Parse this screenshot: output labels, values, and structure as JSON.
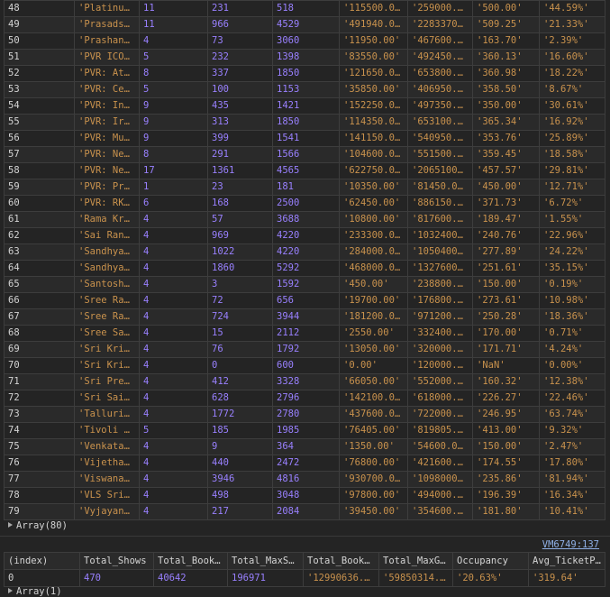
{
  "rows": [
    [
      "48",
      "'Platinum …",
      "11",
      "231",
      "518",
      "'115500.00'",
      "'259000.00'",
      "'500.00'",
      "'44.59%'"
    ],
    [
      "49",
      "'Prasads M…",
      "11",
      "966",
      "4529",
      "'491940.00'",
      "'2283370.0…",
      "'509.25'",
      "'21.33%'"
    ],
    [
      "50",
      "'Prashant …",
      "4",
      "73",
      "3060",
      "'11950.00'",
      "'467600.00'",
      "'163.70'",
      "'2.39%'"
    ],
    [
      "51",
      "'PVR ICON:…",
      "5",
      "232",
      "1398",
      "'83550.00'",
      "'492450.00'",
      "'360.13'",
      "'16.60%'"
    ],
    [
      "52",
      "'PVR: Atri…",
      "8",
      "337",
      "1850",
      "'121650.00'",
      "'653800.00'",
      "'360.98'",
      "'18.22%'"
    ],
    [
      "53",
      "'PVR: Cent…",
      "5",
      "100",
      "1153",
      "'35850.00'",
      "'406950.00'",
      "'358.50'",
      "'8.67%'"
    ],
    [
      "54",
      "'PVR: Inor…",
      "9",
      "435",
      "1421",
      "'152250.00'",
      "'497350.00'",
      "'350.00'",
      "'30.61%'"
    ],
    [
      "55",
      "'PVR: Irru…",
      "9",
      "313",
      "1850",
      "'114350.00'",
      "'653100.00'",
      "'365.34'",
      "'16.92%'"
    ],
    [
      "56",
      "'PVR: Musa…",
      "9",
      "399",
      "1541",
      "'141150.00'",
      "'540950.00'",
      "'353.76'",
      "'25.89%'"
    ],
    [
      "57",
      "'PVR: Next…",
      "8",
      "291",
      "1566",
      "'104600.00'",
      "'551500.00'",
      "'359.45'",
      "'18.58%'"
    ],
    [
      "58",
      "'PVR: Nexu…",
      "17",
      "1361",
      "4565",
      "'622750.00'",
      "'2065100.0…",
      "'457.57'",
      "'29.81%'"
    ],
    [
      "59",
      "'PVR: Pres…",
      "1",
      "23",
      "181",
      "'10350.00'",
      "'81450.00'",
      "'450.00'",
      "'12.71%'"
    ],
    [
      "60",
      "'PVR: RK C…",
      "6",
      "168",
      "2500",
      "'62450.00'",
      "'886150.00'",
      "'371.73'",
      "'6.72%'"
    ],
    [
      "61",
      "'Rama Kris…",
      "4",
      "57",
      "3688",
      "'10800.00'",
      "'817600.00'",
      "'189.47'",
      "'1.55%'"
    ],
    [
      "62",
      "'Sai Ranga…",
      "4",
      "969",
      "4220",
      "'233300.00'",
      "'1032400.0…",
      "'240.76'",
      "'22.96%'"
    ],
    [
      "63",
      "'Sandhya 3…",
      "4",
      "1022",
      "4220",
      "'284000.00'",
      "'1050400.0…",
      "'277.89'",
      "'24.22%'"
    ],
    [
      "64",
      "'Sandhya 7…",
      "4",
      "1860",
      "5292",
      "'468000.00'",
      "'1327600.0…",
      "'251.61'",
      "'35.15%'"
    ],
    [
      "65",
      "'Santosh T…",
      "4",
      "3",
      "1592",
      "'450.00'",
      "'238800.00'",
      "'150.00'",
      "'0.19%'"
    ],
    [
      "66",
      "'Sree Rama…",
      "4",
      "72",
      "656",
      "'19700.00'",
      "'176800.00'",
      "'273.61'",
      "'10.98%'"
    ],
    [
      "67",
      "'Sree Ramu…",
      "4",
      "724",
      "3944",
      "'181200.00'",
      "'971200.00'",
      "'250.28'",
      "'18.36%'"
    ],
    [
      "68",
      "'Sree Sai …",
      "4",
      "15",
      "2112",
      "'2550.00'",
      "'332400.00'",
      "'170.00'",
      "'0.71%'"
    ],
    [
      "69",
      "'Sri Krish…",
      "4",
      "76",
      "1792",
      "'13050.00'",
      "'320000.00'",
      "'171.71'",
      "'4.24%'"
    ],
    [
      "70",
      "'Sri Krish…",
      "4",
      "0",
      "600",
      "'0.00'",
      "'120000.00'",
      "'NaN'",
      "'0.00%'"
    ],
    [
      "71",
      "'Sri Prema…",
      "4",
      "412",
      "3328",
      "'66050.00'",
      "'552000.00'",
      "'160.32'",
      "'12.38%'"
    ],
    [
      "72",
      "'Sri Sai R…",
      "4",
      "628",
      "2796",
      "'142100.00'",
      "'618000.00'",
      "'226.27'",
      "'22.46%'"
    ],
    [
      "73",
      "'Talluri T…",
      "4",
      "1772",
      "2780",
      "'437600.00'",
      "'722000.00'",
      "'246.95'",
      "'63.74%'"
    ],
    [
      "74",
      "'Tivoli Ci…",
      "5",
      "185",
      "1985",
      "'76405.00'",
      "'819805.00'",
      "'413.00'",
      "'9.32%'"
    ],
    [
      "75",
      "'Venkata S…",
      "4",
      "9",
      "364",
      "'1350.00'",
      "'54600.00'",
      "'150.00'",
      "'2.47%'"
    ],
    [
      "76",
      "'Vijetha 7…",
      "4",
      "440",
      "2472",
      "'76800.00'",
      "'421600.00'",
      "'174.55'",
      "'17.80%'"
    ],
    [
      "77",
      "'Viswanath…",
      "4",
      "3946",
      "4816",
      "'930700.00'",
      "'1098000.0…",
      "'235.86'",
      "'81.94%'"
    ],
    [
      "78",
      "'VLS Sride…",
      "4",
      "498",
      "3048",
      "'97800.00'",
      "'494000.00'",
      "'196.39'",
      "'16.34%'"
    ],
    [
      "79",
      "'Vyjayanth…",
      "4",
      "217",
      "2084",
      "'39450.00'",
      "'354600.00'",
      "'181.80'",
      "'10.41%'"
    ]
  ],
  "array_label": "Array(80)",
  "source_link": "VM6749:137",
  "summary": {
    "headers": [
      "(index)",
      "Total_Shows",
      "Total_Booke…",
      "Total_MaxSe…",
      "Total_Booke…",
      "Total_MaxGr…",
      "Occupancy",
      "Avg_TicketP…"
    ],
    "row": [
      "0",
      "470",
      "40642",
      "196971",
      "'12990636.0…",
      "'59850314.0…",
      "'20.63%'",
      "'319.64'"
    ]
  },
  "array2_label": "Array(1)"
}
